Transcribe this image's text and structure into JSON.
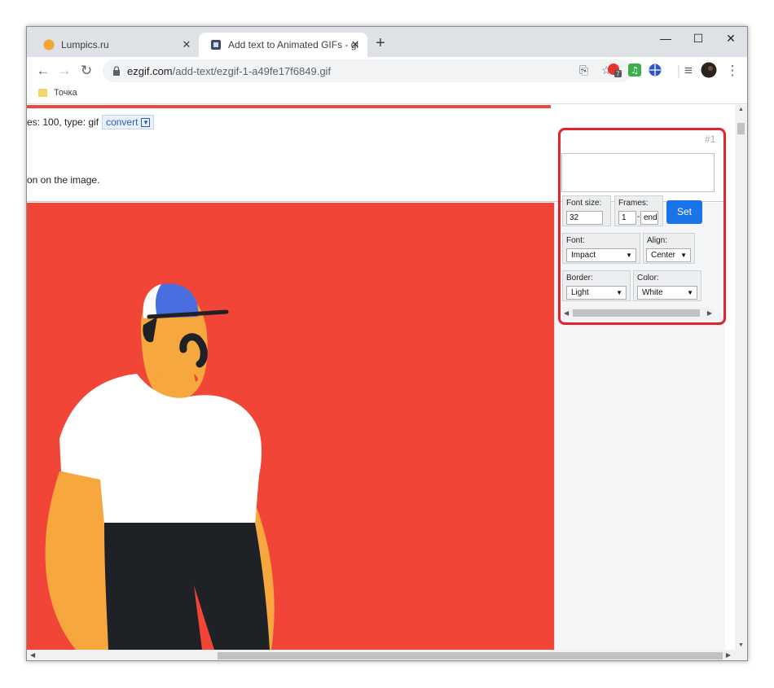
{
  "tabs": [
    {
      "title": "Lumpics.ru",
      "favicon": "lumpics-favicon"
    },
    {
      "title": "Add text to Animated GIFs - gif-m",
      "favicon": "ezgif-favicon"
    }
  ],
  "window_controls": {
    "minimize": "—",
    "maximize": "☐",
    "close": "✕"
  },
  "address": {
    "domain": "ezgif.com",
    "path": "/add-text/ezgif-1-a49fe17f6849.gif"
  },
  "extension_badge": "7",
  "bookmarks": [
    {
      "label": "Точка"
    }
  ],
  "page": {
    "info_text": "es: 100, type: gif",
    "convert_label": "convert",
    "hint_text": "on on the image."
  },
  "panel": {
    "frame_number": "#1",
    "font_size_label": "Font size:",
    "font_size_value": "32",
    "frames_label": "Frames:",
    "frame_from": "1",
    "frame_dash": "-",
    "frame_to": "end",
    "set_label": "Set",
    "font_label": "Font:",
    "font_value": "Impact",
    "align_label": "Align:",
    "align_value": "Center",
    "border_label": "Border:",
    "border_value": "Light",
    "color_label": "Color:",
    "color_value": "White"
  },
  "colors": {
    "accent": "#1a73e8",
    "highlight": "#e0242b",
    "image_bg": "#f14537"
  }
}
